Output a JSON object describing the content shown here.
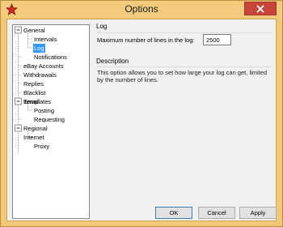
{
  "window": {
    "title": "Options",
    "app_icon": "red-star-icon",
    "close_icon": "close-icon",
    "colors": {
      "frame": "#f0c977",
      "close": "#c7463c",
      "selection": "#3399ff"
    }
  },
  "tree": {
    "items": [
      {
        "label": "General",
        "expander": "-"
      },
      {
        "label": "Intervals"
      },
      {
        "label": "Log",
        "selected": true
      },
      {
        "label": "Notifications"
      },
      {
        "label": "eBay Accounts"
      },
      {
        "label": "Withdrawals"
      },
      {
        "label": "Replies"
      },
      {
        "label": "Blacklist"
      },
      {
        "label": "Email"
      },
      {
        "label": "Templates",
        "expander": "-"
      },
      {
        "label": "Posting"
      },
      {
        "label": "Requesting"
      },
      {
        "label": "Regional"
      },
      {
        "label": "Internet",
        "expander": "-"
      },
      {
        "label": "Proxy"
      }
    ]
  },
  "log_group": {
    "title": "Log",
    "max_lines_label": "Maximum number of lines in the log:",
    "max_lines_value": "2500"
  },
  "description_group": {
    "title": "Description",
    "text": "This option allows you to set how large your log can get, limited by the number of lines."
  },
  "buttons": {
    "ok": "OK",
    "cancel": "Cancel",
    "apply": "Apply"
  }
}
